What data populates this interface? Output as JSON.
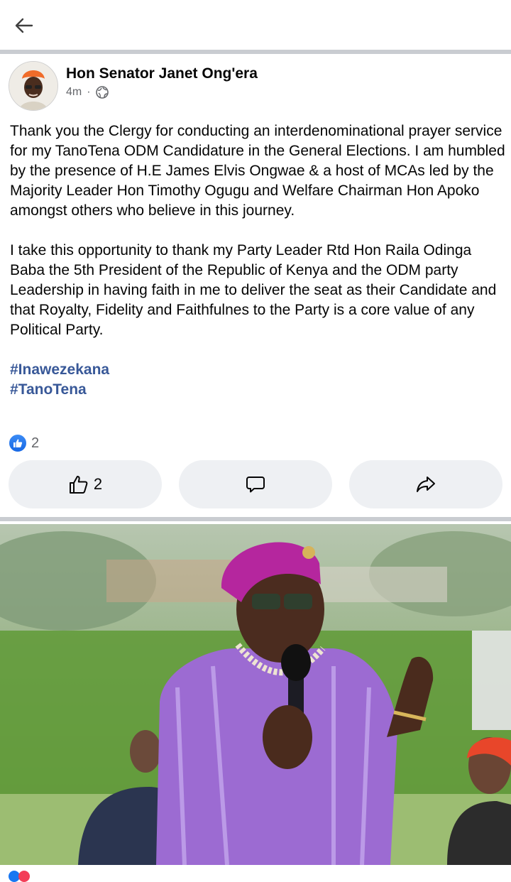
{
  "post": {
    "author": "Hon Senator Janet Ong'era",
    "time": "4m",
    "separator": "·",
    "paragraphs": [
      "Thank you the Clergy for conducting an interdenominational prayer service for my TanoTena   ODM Candidature in the General Elections. I am humbled by the presence of H.E James Elvis Ongwae &  a host of MCAs led by the Majority Leader  Hon Timothy Ogugu  and Welfare Chairman Hon Apoko amongst others  who  believe in this journey.",
      "I take this opportunity to thank my Party Leader Rtd Hon  Raila Odinga  Baba the 5th  President of the Republic of Kenya and the ODM party Leadership in having faith in me to  deliver the seat as their Candidate and that Royalty, Fidelity and Faithfulnes to the Party is a core value of any Political Party."
    ],
    "hashtags": [
      "#Inawezekana",
      "#TanoTena"
    ],
    "reaction_count": "2",
    "like_button_count": "2"
  },
  "icons": {
    "back": "arrow-left-icon",
    "privacy": "globe-icon",
    "reaction": "like-reaction-icon",
    "like": "thumbs-up-icon",
    "comment": "comment-icon",
    "share": "share-icon"
  },
  "colors": {
    "hashtag": "#385898",
    "like_blue": "#1877f2",
    "divider": "#c9ccd1",
    "button_bg": "#eef0f3"
  }
}
